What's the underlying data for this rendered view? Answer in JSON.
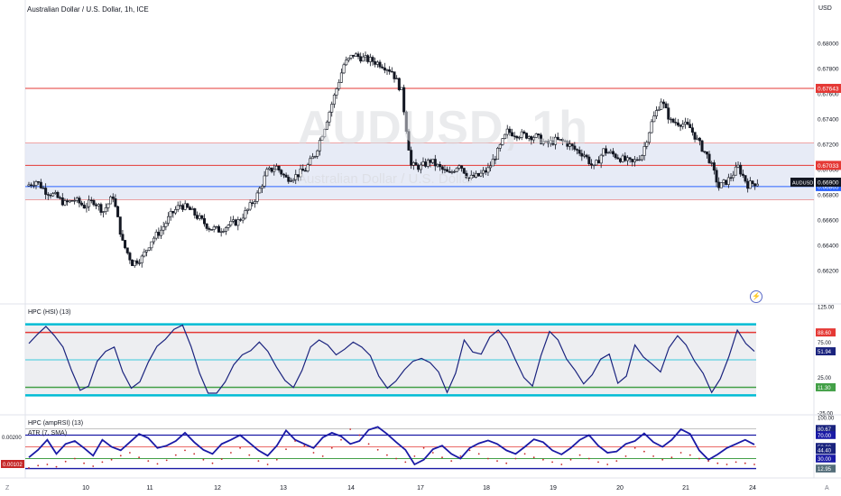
{
  "header": {
    "symbol_title": "Australian Dollar / U.S. Dollar, 1h, ICE",
    "currency": "USD"
  },
  "watermark": {
    "symbol": "AUDUSD, 1h",
    "name": "Australian Dollar / U.S. Dollar"
  },
  "colors": {
    "red_line": "#e53935",
    "blue_line": "#2962ff",
    "band_fill": "#e3e7f4",
    "candle": "#131722",
    "hsi_line": "#1a237e",
    "cyan": "#00bcd4",
    "green": "#43a047",
    "dot_red": "#c62828",
    "dark_blue": "#1a1aa6"
  },
  "chart_data": [
    {
      "type": "candlestick",
      "title": "Australian Dollar / U.S. Dollar, 1h, ICE",
      "ylabel": "USD",
      "ylim": [
        0.6595,
        0.682
      ],
      "y_ticks": [
        "0.68000",
        "0.67800",
        "0.67600",
        "0.67400",
        "0.67200",
        "0.67000",
        "0.66800",
        "0.66600",
        "0.66400",
        "0.66200"
      ],
      "x_ticks": [
        "10",
        "11",
        "12",
        "13",
        "14",
        "17",
        "18",
        "19",
        "20",
        "21",
        "24"
      ],
      "price_path": [
        0.6687,
        0.6691,
        0.6683,
        0.6679,
        0.6673,
        0.6676,
        0.6671,
        0.6675,
        0.6667,
        0.6679,
        0.6642,
        0.6626,
        0.663,
        0.6644,
        0.6652,
        0.6664,
        0.6672,
        0.6668,
        0.6661,
        0.6654,
        0.6652,
        0.6656,
        0.6659,
        0.6668,
        0.668,
        0.6698,
        0.6702,
        0.6693,
        0.6695,
        0.67,
        0.6712,
        0.6734,
        0.6758,
        0.6783,
        0.6791,
        0.6788,
        0.6786,
        0.6783,
        0.6778,
        0.6762,
        0.6703,
        0.6702,
        0.6707,
        0.6701,
        0.6696,
        0.6705,
        0.6693,
        0.6695,
        0.67,
        0.6714,
        0.673,
        0.6728,
        0.6727,
        0.6726,
        0.672,
        0.6723,
        0.6722,
        0.6716,
        0.6712,
        0.6701,
        0.6715,
        0.6712,
        0.6708,
        0.6705,
        0.6712,
        0.6737,
        0.6755,
        0.6738,
        0.6737,
        0.6733,
        0.672,
        0.6708,
        0.6686,
        0.6692,
        0.6702,
        0.6688,
        0.669
      ],
      "last_price": "0.66900",
      "last_label": "AUDUSD",
      "levels": [
        {
          "label": "0.67643",
          "color": "#e53935"
        },
        {
          "label": "0.67033",
          "color": "#e53935"
        },
        {
          "label": "0.66865",
          "color": "#2962ff"
        }
      ],
      "extra_lines": [
        0.6721,
        0.6676
      ],
      "band": [
        0.6676,
        0.6721
      ]
    },
    {
      "type": "line",
      "title": "HPC (HSI) (13)",
      "ylim": [
        -25,
        125
      ],
      "y_ticks": [
        "125.00",
        "75.00",
        "25.00",
        "-25.00"
      ],
      "levels": [
        100,
        88.6,
        11.3,
        0
      ],
      "level_labels": [
        "88.60",
        "11.30"
      ],
      "current_label": "51.94",
      "values": [
        73,
        86,
        97,
        84,
        68,
        35,
        7,
        13,
        48,
        62,
        68,
        33,
        10,
        19,
        47,
        69,
        79,
        93,
        99,
        69,
        31,
        3,
        3,
        19,
        43,
        57,
        63,
        75,
        62,
        40,
        21,
        11,
        35,
        68,
        78,
        71,
        57,
        65,
        75,
        68,
        56,
        27,
        10,
        20,
        36,
        48,
        52,
        46,
        33,
        4,
        31,
        78,
        61,
        58,
        82,
        92,
        77,
        50,
        25,
        13,
        56,
        90,
        78,
        51,
        35,
        16,
        29,
        51,
        58,
        17,
        27,
        71,
        54,
        44,
        33,
        67,
        84,
        71,
        48,
        31,
        4,
        23,
        54,
        92,
        73,
        62
      ]
    },
    {
      "type": "line",
      "title": "HPC (ampRSI) (13)",
      "ylim": [
        0,
        100
      ],
      "y_ticks": [
        "100.00",
        "0.00200"
      ],
      "levels": [
        70,
        50,
        30
      ],
      "level_labels": [
        "80.67",
        "70.00",
        "50.00",
        "44.40",
        "30.00",
        "12.95"
      ],
      "values": [
        32,
        45,
        62,
        38,
        55,
        60,
        48,
        35,
        62,
        50,
        44,
        58,
        72,
        65,
        48,
        52,
        60,
        74,
        58,
        45,
        38,
        55,
        62,
        70,
        57,
        44,
        35,
        52,
        78,
        62,
        55,
        48,
        66,
        74,
        68,
        55,
        60,
        79,
        84,
        72,
        58,
        45,
        20,
        28,
        46,
        52,
        38,
        30,
        48,
        56,
        61,
        55,
        44,
        38,
        50,
        63,
        58,
        44,
        37,
        48,
        62,
        70,
        52,
        40,
        42,
        55,
        60,
        73,
        58,
        50,
        62,
        80,
        72,
        44,
        28,
        37,
        48,
        55,
        62,
        54
      ]
    },
    {
      "type": "line",
      "title": "ATR (7, SMA)",
      "y_ticks": [
        "0.00200",
        "0.00102"
      ],
      "current_label": "0.00102",
      "values": [
        14,
        18,
        20,
        16,
        25,
        30,
        22,
        17,
        24,
        28,
        35,
        40,
        32,
        26,
        21,
        27,
        36,
        44,
        38,
        28,
        22,
        29,
        40,
        48,
        36,
        26,
        20,
        28,
        46,
        60,
        52,
        40,
        34,
        48,
        62,
        80,
        70,
        55,
        45,
        36,
        30,
        24,
        34,
        48,
        40,
        32,
        26,
        34,
        44,
        38,
        30,
        26,
        22,
        30,
        38,
        32,
        28,
        24,
        20,
        28,
        36,
        30,
        24,
        20,
        26,
        34,
        48,
        42,
        34,
        28,
        32,
        40,
        36,
        30,
        26,
        22,
        20,
        24,
        22,
        20
      ]
    }
  ],
  "time_axis": {
    "left_icon": "Z",
    "right_icon": "A",
    "labels": [
      "10",
      "11",
      "12",
      "13",
      "14",
      "17",
      "18",
      "19",
      "20",
      "21",
      "24"
    ]
  },
  "icons": [
    "lightning-icon"
  ]
}
